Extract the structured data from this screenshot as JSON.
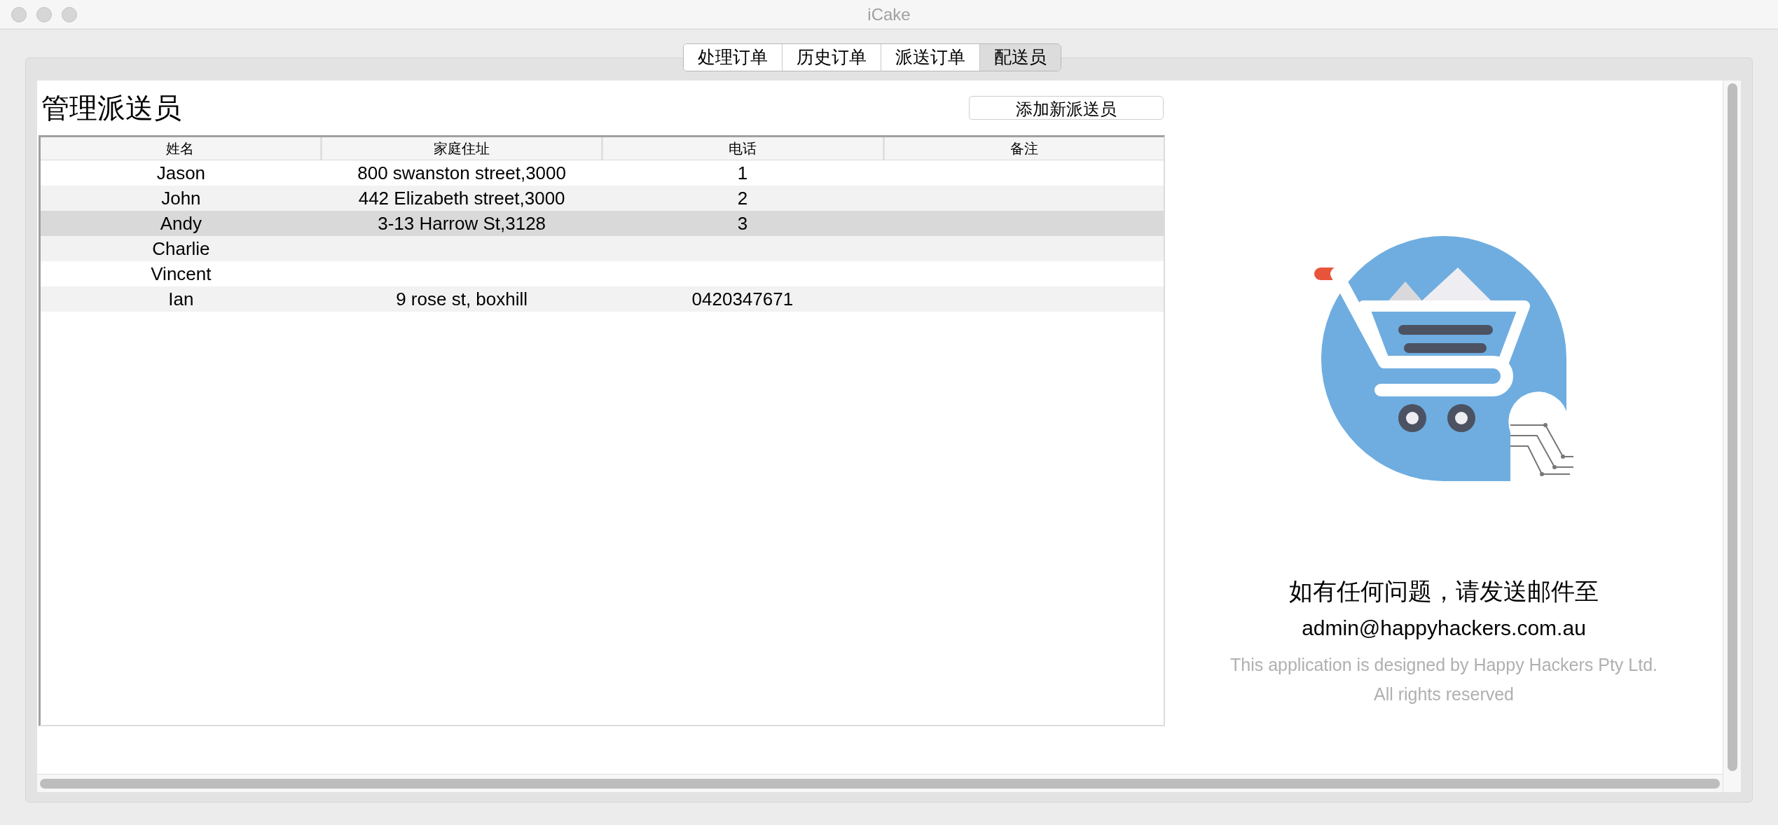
{
  "window": {
    "title": "iCake"
  },
  "tabs": [
    {
      "label": "处理订单",
      "selected": false
    },
    {
      "label": "历史订单",
      "selected": false
    },
    {
      "label": "派送订单",
      "selected": false
    },
    {
      "label": "配送员",
      "selected": true
    }
  ],
  "page_title": "管理派送员",
  "add_button": "添加新派送员",
  "table": {
    "columns": [
      "姓名",
      "家庭住址",
      "电话",
      "备注"
    ],
    "rows": [
      {
        "cells": [
          "Jason",
          "800 swanston street,3000",
          "1",
          ""
        ],
        "selected": false
      },
      {
        "cells": [
          "John",
          "442 Elizabeth street,3000",
          "2",
          ""
        ],
        "selected": false
      },
      {
        "cells": [
          "Andy",
          "3-13 Harrow St,3128",
          "3",
          ""
        ],
        "selected": true
      },
      {
        "cells": [
          "Charlie",
          "",
          "",
          ""
        ],
        "selected": false
      },
      {
        "cells": [
          "Vincent",
          "",
          "",
          ""
        ],
        "selected": false
      },
      {
        "cells": [
          "Ian",
          "9 rose st, boxhill",
          "0420347671",
          ""
        ],
        "selected": false
      }
    ]
  },
  "contact": {
    "heading": "如有任何问题，请发送邮件至",
    "email": "admin@happyhackers.com.au",
    "credit": "This application is designed by  Happy Hackers Pty Ltd.",
    "rights": "All rights reserved"
  }
}
